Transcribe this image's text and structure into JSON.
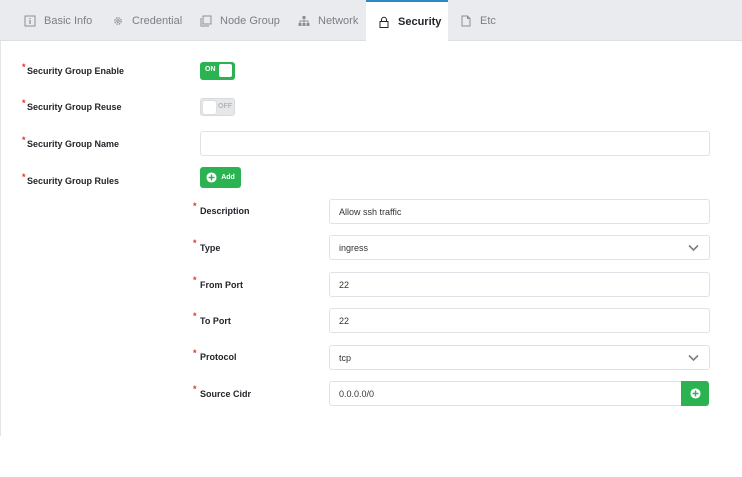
{
  "tabs": [
    {
      "label": "Basic Info",
      "icon": "info-icon",
      "active": false
    },
    {
      "label": "Credential",
      "icon": "gear-icon",
      "active": false
    },
    {
      "label": "Node Group",
      "icon": "copy-icon",
      "active": false
    },
    {
      "label": "Network",
      "icon": "network-icon",
      "active": false
    },
    {
      "label": "Security",
      "icon": "lock-icon",
      "active": true
    },
    {
      "label": "Etc",
      "icon": "file-icon",
      "active": false
    }
  ],
  "form": {
    "enable": {
      "label": "Security Group Enable",
      "toggle_text": "ON",
      "value": true
    },
    "reuse": {
      "label": "Security Group Reuse",
      "toggle_text": "OFF",
      "value": false
    },
    "name": {
      "label": "Security Group Name",
      "value": ""
    },
    "rules": {
      "label": "Security Group Rules",
      "add_label": "Add"
    }
  },
  "rule": {
    "description": {
      "label": "Description",
      "value": "Allow ssh traffic"
    },
    "type": {
      "label": "Type",
      "value": "ingress"
    },
    "from_port": {
      "label": "From Port",
      "value": "22"
    },
    "to_port": {
      "label": "To Port",
      "value": "22"
    },
    "protocol": {
      "label": "Protocol",
      "value": "tcp"
    },
    "source_cidr": {
      "label": "Source Cidr",
      "value": "0.0.0.0/0"
    }
  },
  "colors": {
    "accent_green": "#2bb352",
    "required_red": "#e0312b",
    "tab_active_border": "#2b8cc4"
  }
}
